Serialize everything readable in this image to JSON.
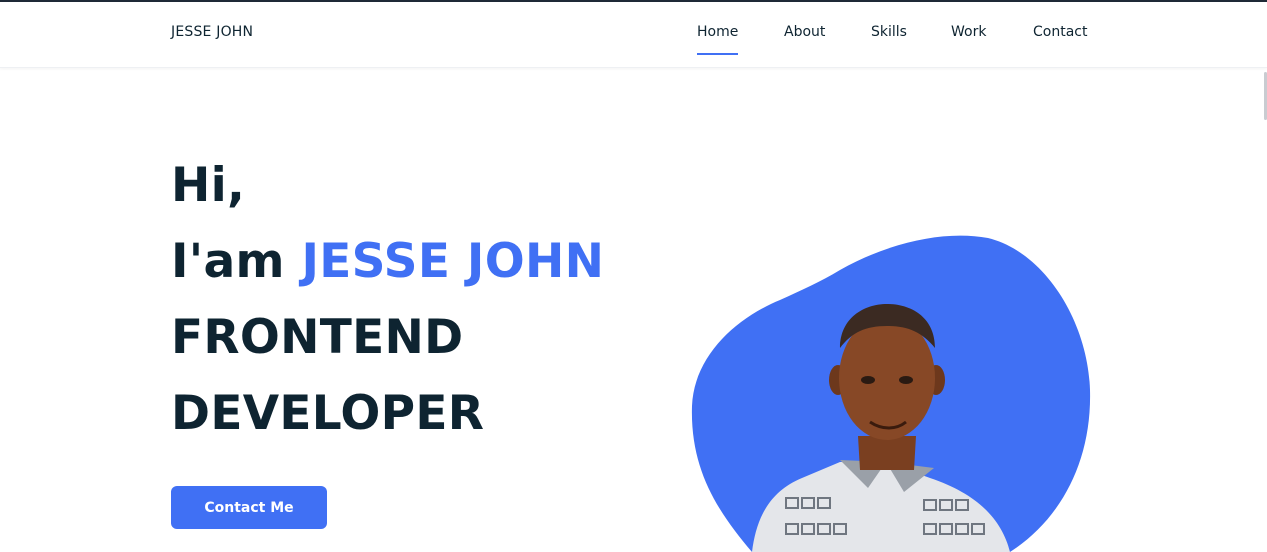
{
  "header": {
    "logo": "JESSE JOHN",
    "nav": [
      {
        "label": "Home",
        "active": true
      },
      {
        "label": "About",
        "active": false
      },
      {
        "label": "Skills",
        "active": false
      },
      {
        "label": "Work",
        "active": false
      },
      {
        "label": "Contact",
        "active": false
      }
    ]
  },
  "hero": {
    "greeting": "Hi,",
    "intro_prefix": "I'am",
    "name": "JESSE JOHN",
    "role_line1": "FRONTEND",
    "role_line2": "DEVELOPER",
    "cta_label": "Contact Me"
  },
  "colors": {
    "accent": "#4070f4",
    "text": "#0e2431",
    "background": "#ffffff"
  },
  "icons": [
    "profile-photo"
  ]
}
